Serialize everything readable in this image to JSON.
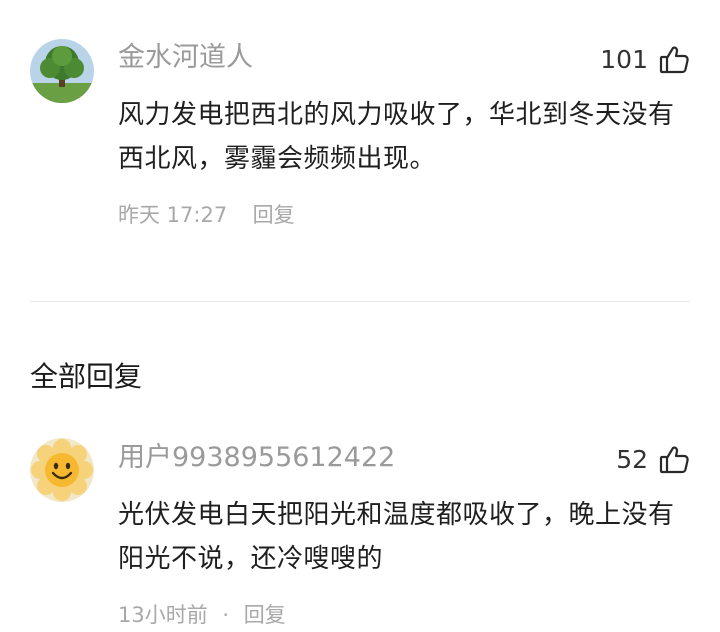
{
  "comment": {
    "username": "金水河道人",
    "like_count": "101",
    "text": "风力发电把西北的风力吸收了，华北到冬天没有西北风，雾霾会频频出现。",
    "time": "昨天 17:27",
    "reply_label": "回复"
  },
  "section_title": "全部回复",
  "reply": {
    "username": "用户9938955612422",
    "like_count": "52",
    "text": "光伏发电白天把阳光和温度都吸收了，晚上没有阳光不说，还冷嗖嗖的",
    "time": "13小时前",
    "separator": "·",
    "reply_label": "回复"
  },
  "icons": {
    "like": "thumbs-up-outline-icon"
  },
  "colors": {
    "username": "#9a9a9a",
    "meta": "#a8a8a8",
    "text": "#1f1f1f",
    "divider": "#e8e8e8"
  }
}
